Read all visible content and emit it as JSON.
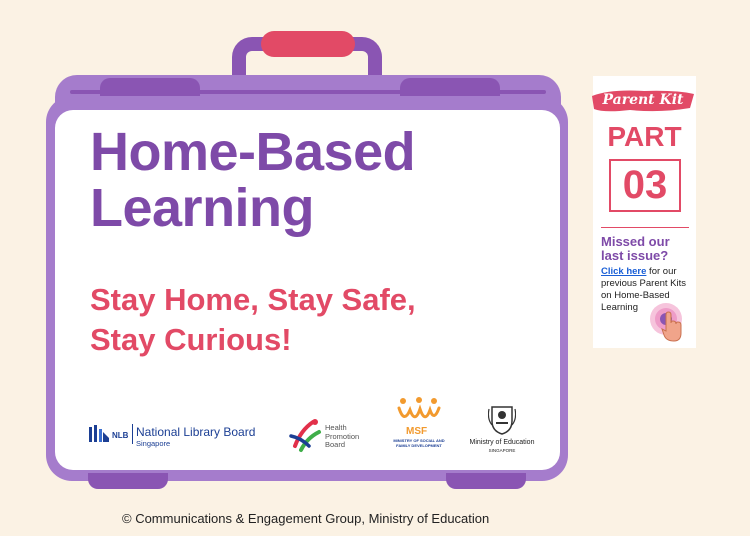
{
  "cover": {
    "title_line1": "Home-Based",
    "title_line2": "Learning",
    "subtitle_line1": "Stay Home, Stay Safe,",
    "subtitle_line2": "Stay Curious!"
  },
  "logos": {
    "nlb_abbr": "NLB",
    "nlb_name": "National Library Board",
    "nlb_sub": "Singapore",
    "hpb_line1": "Health",
    "hpb_line2": "Promotion",
    "hpb_line3": "Board",
    "msf_abbr": "MSF",
    "msf_full": "MINISTRY OF SOCIAL AND FAMILY DEVELOPMENT",
    "moe_name": "Ministry of Education",
    "moe_sub": "SINGAPORE"
  },
  "sidecard": {
    "badge": "Parent Kit",
    "part_label": "PART",
    "part_number": "03",
    "missed": "Missed our last issue?",
    "link_text": "Click here",
    "blurb_rest": " for our previous Parent Kits on Home-Based Learning"
  },
  "footer": {
    "copyright": "© Communications & Engagement Group, Ministry of Education"
  },
  "colors": {
    "purple": "#7e4aa8",
    "suitcase": "#a57ccc",
    "pink": "#e24a66",
    "background": "#fbf2e4"
  },
  "icons": [
    "click-pointer-icon",
    "nlb-logo-icon",
    "hpb-logo-icon",
    "msf-logo-icon",
    "moe-crest-icon"
  ]
}
